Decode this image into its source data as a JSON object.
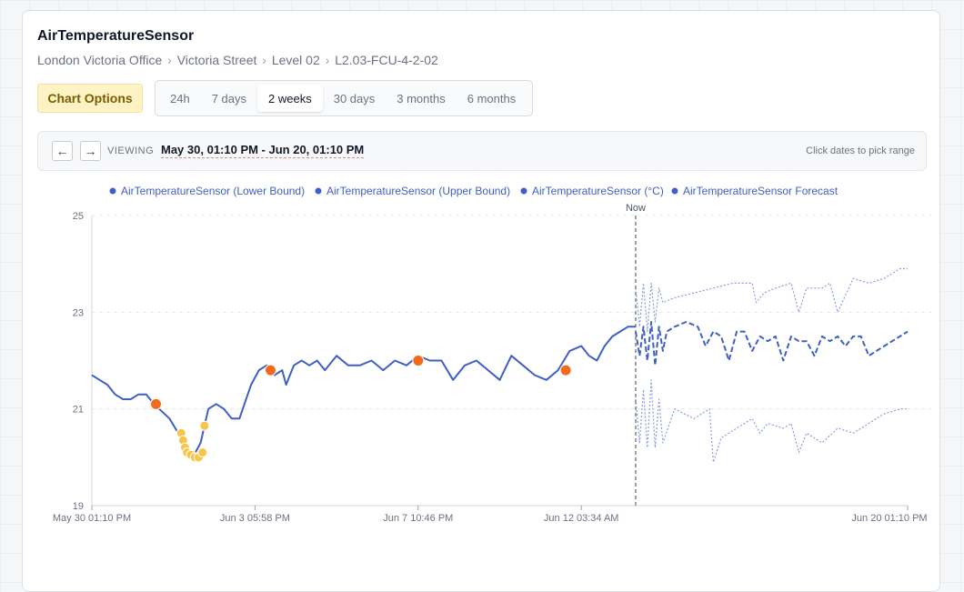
{
  "card": {
    "title": "AirTemperatureSensor",
    "breadcrumb": [
      "London Victoria Office",
      "Victoria Street",
      "Level 02",
      "L2.03-FCU-4-2-02"
    ],
    "breadcrumb_separator": "›"
  },
  "toolbar": {
    "chart_options_label": "Chart Options",
    "ranges": [
      "24h",
      "7 days",
      "2 weeks",
      "30 days",
      "3 months",
      "6 months"
    ],
    "active_range": "2 weeks"
  },
  "viewer": {
    "prev_label": "←",
    "next_label": "→",
    "viewing_label": "VIEWING",
    "range_text": "May 30, 01:10 PM - Jun 20, 01:10 PM",
    "hint": "Click dates to pick range"
  },
  "colors": {
    "series": "#3f5fc6",
    "forecast": "#8a9de0",
    "anomaly_high": "#f26a1b",
    "anomaly_low": "#f7c548",
    "now_line": "#9aa3ad",
    "grid": "#e6e8ec"
  },
  "chart_data": {
    "type": "line",
    "ylim": [
      19,
      25
    ],
    "yticks": [
      19,
      21,
      23,
      25
    ],
    "x_tick_labels": [
      "May 30 01:10 PM",
      "Jun 3 05:58 PM",
      "Jun 7 10:46 PM",
      "Jun 12 03:34 AM",
      "Jun 20 01:10 PM"
    ],
    "x_tick_positions_days": [
      0,
      4.2,
      8.4,
      12.6,
      21
    ],
    "x_range_days": [
      0,
      21
    ],
    "now_label": "Now",
    "now_day": 14,
    "legend": [
      "AirTemperatureSensor (Lower Bound)",
      "AirTemperatureSensor (Upper Bound)",
      "AirTemperatureSensor (°C)",
      "AirTemperatureSensor Forecast"
    ],
    "grid": true,
    "series": [
      {
        "name": "AirTemperatureSensor (°C)",
        "x": [
          0,
          0.2,
          0.4,
          0.6,
          0.8,
          1.0,
          1.2,
          1.4,
          1.6,
          2.0,
          2.3,
          2.6,
          2.8,
          3.0,
          3.2,
          3.4,
          3.6,
          3.8,
          4.1,
          4.3,
          4.5,
          4.7,
          4.9,
          5.0,
          5.2,
          5.4,
          5.6,
          5.8,
          6.0,
          6.3,
          6.6,
          6.9,
          7.2,
          7.5,
          7.8,
          8.1,
          8.4,
          8.7,
          9.0,
          9.3,
          9.6,
          9.9,
          10.2,
          10.5,
          10.8,
          11.1,
          11.4,
          11.7,
          12.0,
          12.3,
          12.6,
          12.8,
          13.0,
          13.2,
          13.4,
          13.6,
          13.8,
          14.0
        ],
        "values": [
          21.7,
          21.6,
          21.5,
          21.3,
          21.2,
          21.2,
          21.3,
          21.3,
          21.1,
          20.8,
          20.4,
          20.0,
          20.3,
          21.0,
          21.1,
          21.0,
          20.8,
          20.8,
          21.5,
          21.8,
          21.9,
          21.7,
          21.8,
          21.5,
          21.9,
          22.0,
          21.9,
          22.0,
          21.8,
          22.1,
          21.9,
          21.9,
          22.0,
          21.8,
          22.0,
          21.9,
          22.1,
          22.0,
          22.0,
          21.6,
          21.9,
          22.0,
          21.8,
          21.6,
          22.1,
          21.9,
          21.7,
          21.6,
          21.8,
          22.2,
          22.3,
          22.1,
          22.0,
          22.3,
          22.5,
          22.6,
          22.7,
          22.7
        ]
      },
      {
        "name": "AirTemperatureSensor Forecast",
        "x": [
          14.0,
          14.1,
          14.2,
          14.3,
          14.4,
          14.5,
          14.6,
          14.7,
          14.8,
          15.0,
          15.3,
          15.6,
          15.8,
          16.0,
          16.2,
          16.4,
          16.6,
          16.8,
          17.0,
          17.2,
          17.4,
          17.6,
          17.8,
          18.0,
          18.2,
          18.4,
          18.6,
          18.8,
          19.0,
          19.2,
          19.4,
          19.6,
          19.8,
          20.0,
          20.2,
          20.4,
          20.6,
          20.8,
          21.0
        ],
        "values": [
          22.6,
          22.1,
          22.7,
          22.0,
          22.8,
          21.9,
          22.7,
          22.2,
          22.6,
          22.7,
          22.8,
          22.7,
          22.3,
          22.6,
          22.5,
          22.0,
          22.6,
          22.6,
          22.2,
          22.5,
          22.4,
          22.5,
          22.0,
          22.5,
          22.4,
          22.4,
          22.1,
          22.5,
          22.4,
          22.5,
          22.3,
          22.5,
          22.5,
          22.1,
          22.2,
          22.3,
          22.4,
          22.5,
          22.6
        ]
      },
      {
        "name": "AirTemperatureSensor (Upper Bound)",
        "x": [
          14.0,
          14.1,
          14.2,
          14.3,
          14.4,
          14.5,
          14.6,
          14.7,
          15.0,
          15.5,
          16.0,
          16.5,
          17.0,
          17.1,
          17.3,
          17.6,
          18.0,
          18.2,
          18.4,
          18.8,
          19.0,
          19.2,
          19.6,
          20.0,
          20.4,
          20.8,
          21.0
        ],
        "values": [
          23.5,
          22.7,
          23.6,
          22.6,
          23.6,
          22.8,
          23.5,
          23.2,
          23.3,
          23.4,
          23.5,
          23.6,
          23.6,
          23.2,
          23.4,
          23.5,
          23.6,
          23.0,
          23.5,
          23.5,
          23.6,
          23.0,
          23.7,
          23.6,
          23.7,
          23.9,
          23.9
        ]
      },
      {
        "name": "AirTemperatureSensor (Lower Bound)",
        "x": [
          14.0,
          14.1,
          14.2,
          14.3,
          14.4,
          14.5,
          14.6,
          14.7,
          15.0,
          15.5,
          15.9,
          16.0,
          16.2,
          16.6,
          17.0,
          17.2,
          17.4,
          17.8,
          18.0,
          18.2,
          18.4,
          18.8,
          19.2,
          19.6,
          20.0,
          20.4,
          20.8,
          21.0
        ],
        "values": [
          21.2,
          20.3,
          21.4,
          20.2,
          21.6,
          20.2,
          21.2,
          20.3,
          21.0,
          20.8,
          21.0,
          19.9,
          20.4,
          20.6,
          20.8,
          20.5,
          20.7,
          20.6,
          20.7,
          20.1,
          20.5,
          20.3,
          20.6,
          20.5,
          20.7,
          20.9,
          21.0,
          21.0
        ]
      }
    ],
    "anomalies_high": [
      {
        "x": 1.65,
        "y": 21.1
      },
      {
        "x": 4.6,
        "y": 21.8
      },
      {
        "x": 8.4,
        "y": 22.0
      },
      {
        "x": 12.2,
        "y": 21.8
      }
    ],
    "anomalies_low": [
      {
        "x": 2.3,
        "y": 20.5
      },
      {
        "x": 2.35,
        "y": 20.35
      },
      {
        "x": 2.4,
        "y": 20.2
      },
      {
        "x": 2.45,
        "y": 20.1
      },
      {
        "x": 2.55,
        "y": 20.05
      },
      {
        "x": 2.65,
        "y": 20.0
      },
      {
        "x": 2.75,
        "y": 20.0
      },
      {
        "x": 2.85,
        "y": 20.1
      },
      {
        "x": 2.9,
        "y": 20.65
      }
    ]
  }
}
